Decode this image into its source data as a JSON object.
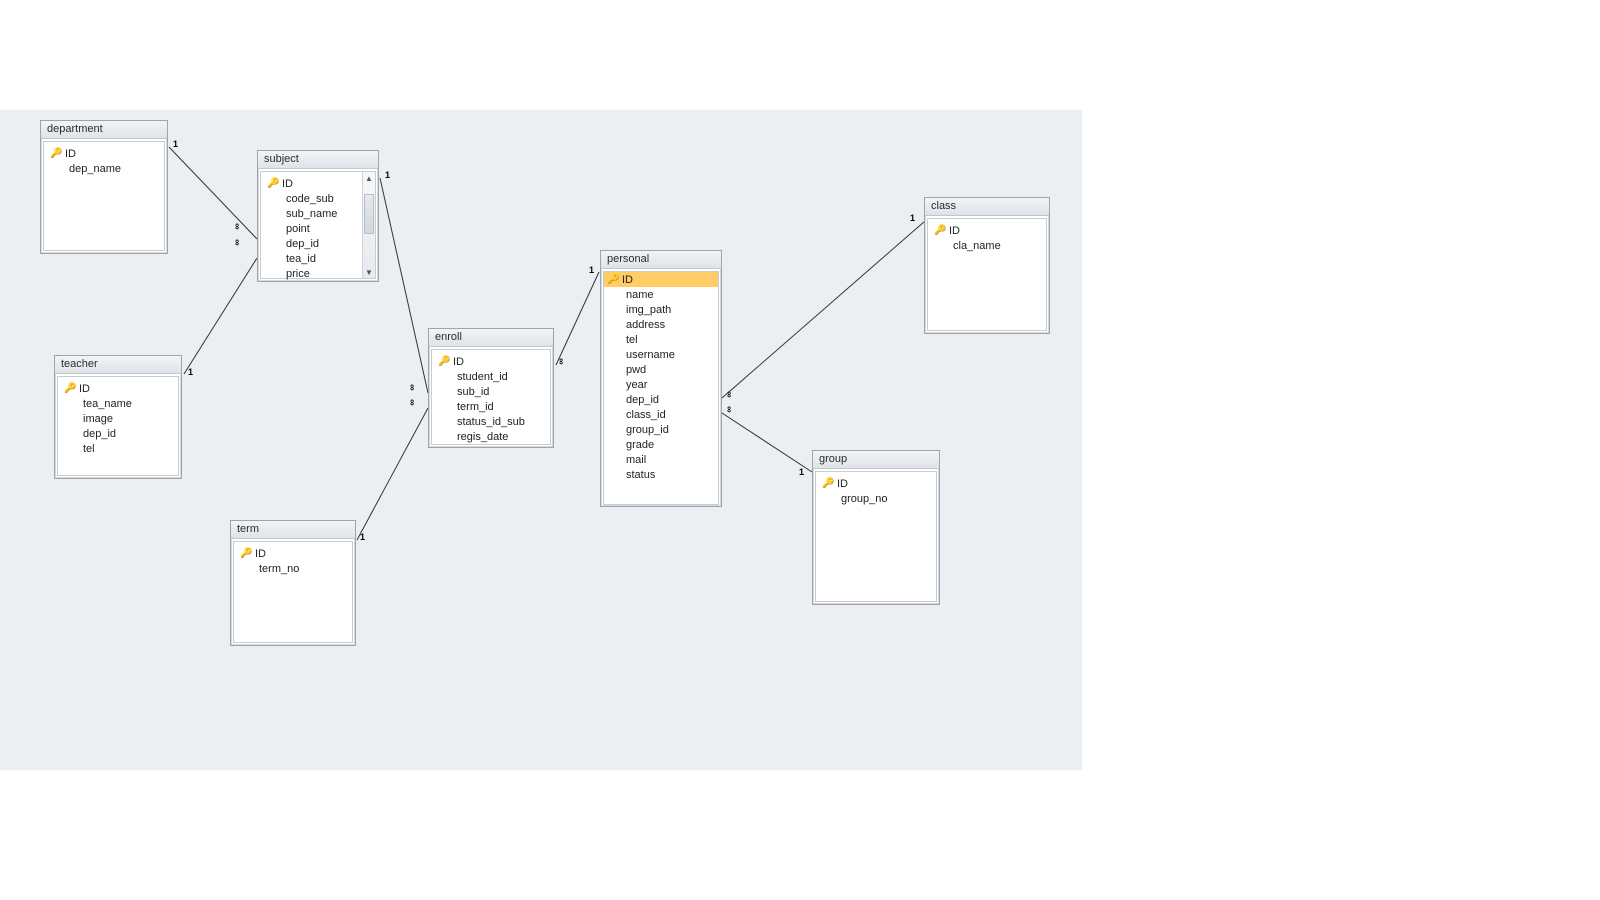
{
  "entities": {
    "department": {
      "title": "department",
      "fields": [
        {
          "name": "ID",
          "key": true
        },
        {
          "name": "dep_name",
          "key": false
        }
      ]
    },
    "subject": {
      "title": "subject",
      "fields": [
        {
          "name": "ID",
          "key": true
        },
        {
          "name": "code_sub",
          "key": false
        },
        {
          "name": "sub_name",
          "key": false
        },
        {
          "name": "point",
          "key": false
        },
        {
          "name": "dep_id",
          "key": false
        },
        {
          "name": "tea_id",
          "key": false
        },
        {
          "name": "price",
          "key": false
        }
      ],
      "has_scrollbar": true
    },
    "teacher": {
      "title": "teacher",
      "fields": [
        {
          "name": "ID",
          "key": true
        },
        {
          "name": "tea_name",
          "key": false
        },
        {
          "name": "image",
          "key": false
        },
        {
          "name": "dep_id",
          "key": false
        },
        {
          "name": "tel",
          "key": false
        }
      ]
    },
    "term": {
      "title": "term",
      "fields": [
        {
          "name": "ID",
          "key": true
        },
        {
          "name": "term_no",
          "key": false
        }
      ]
    },
    "enroll": {
      "title": "enroll",
      "fields": [
        {
          "name": "ID",
          "key": true
        },
        {
          "name": "student_id",
          "key": false
        },
        {
          "name": "sub_id",
          "key": false
        },
        {
          "name": "term_id",
          "key": false
        },
        {
          "name": "status_id_sub",
          "key": false
        },
        {
          "name": "regis_date",
          "key": false
        }
      ]
    },
    "personal": {
      "title": "personal",
      "fields": [
        {
          "name": "ID",
          "key": true,
          "selected": true
        },
        {
          "name": "name",
          "key": false
        },
        {
          "name": "img_path",
          "key": false
        },
        {
          "name": "address",
          "key": false
        },
        {
          "name": "tel",
          "key": false
        },
        {
          "name": "username",
          "key": false
        },
        {
          "name": "pwd",
          "key": false
        },
        {
          "name": "year",
          "key": false
        },
        {
          "name": "dep_id",
          "key": false
        },
        {
          "name": "class_id",
          "key": false
        },
        {
          "name": "group_id",
          "key": false
        },
        {
          "name": "grade",
          "key": false
        },
        {
          "name": "mail",
          "key": false
        },
        {
          "name": "status",
          "key": false
        }
      ]
    },
    "class": {
      "title": "class",
      "fields": [
        {
          "name": "ID",
          "key": true
        },
        {
          "name": "cla_name",
          "key": false
        }
      ]
    },
    "group": {
      "title": "group",
      "fields": [
        {
          "name": "ID",
          "key": true
        },
        {
          "name": "group_no",
          "key": false
        }
      ]
    }
  },
  "cardinality": {
    "one": "1",
    "many": "∞"
  },
  "relationship_lines": [
    {
      "from": "department",
      "to": "subject",
      "from_card": "1",
      "to_card": "∞"
    },
    {
      "from": "teacher",
      "to": "subject",
      "from_card": "1",
      "to_card": "∞"
    },
    {
      "from": "subject",
      "to": "enroll",
      "from_card": "1",
      "to_card": "∞"
    },
    {
      "from": "term",
      "to": "enroll",
      "from_card": "1",
      "to_card": "∞"
    },
    {
      "from": "personal",
      "to": "enroll",
      "from_card": "1",
      "to_card": "∞"
    },
    {
      "from": "class",
      "to": "personal",
      "from_card": "1",
      "to_card": "∞"
    },
    {
      "from": "group",
      "to": "personal",
      "from_card": "1",
      "to_card": "∞"
    }
  ]
}
